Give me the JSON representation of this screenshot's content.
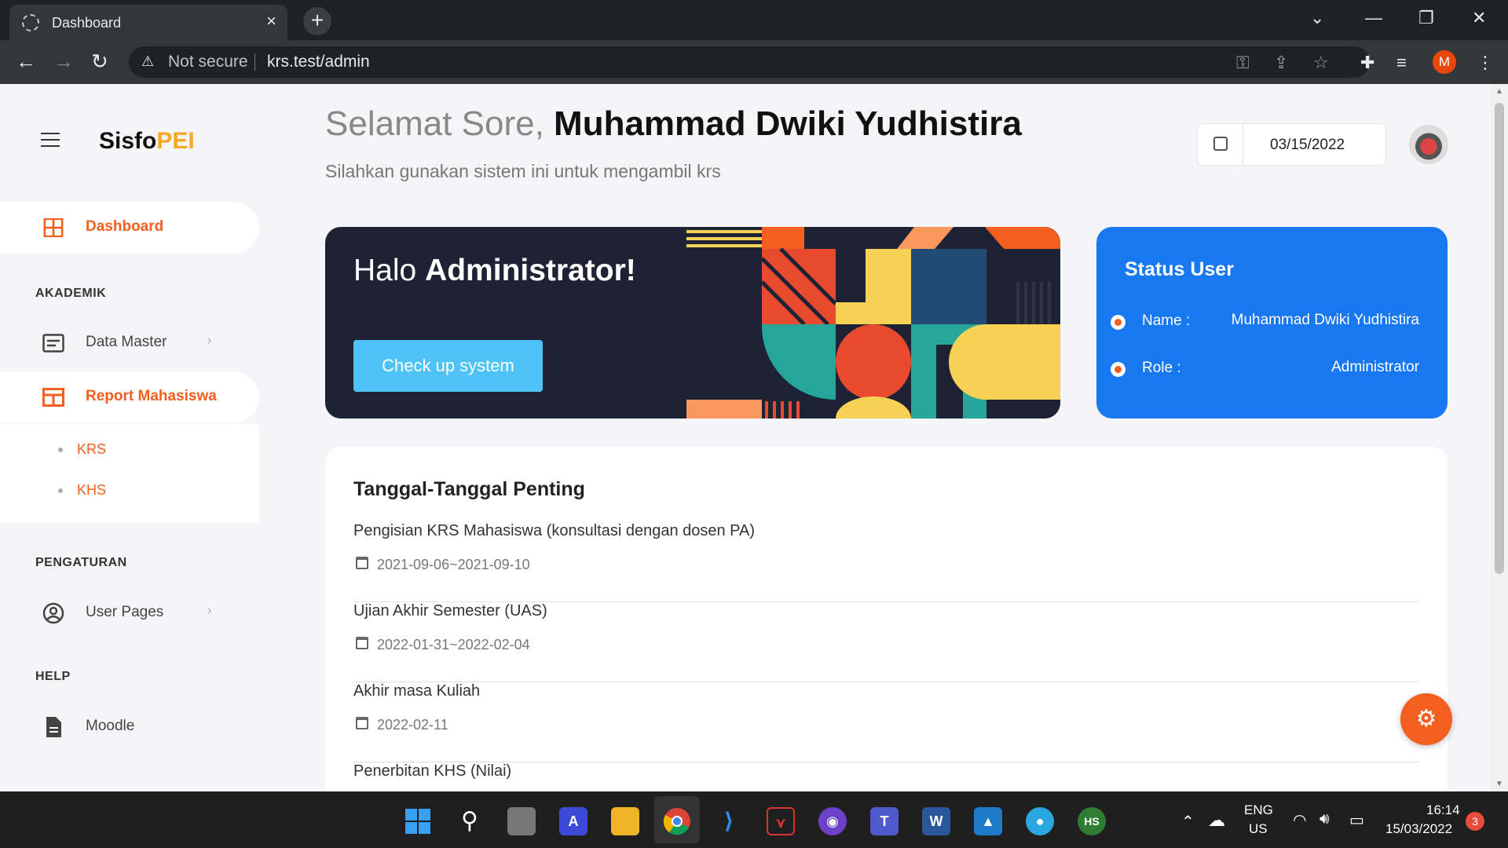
{
  "browser": {
    "tab_title": "Dashboard",
    "security_label": "Not secure",
    "url": "krs.test/admin",
    "profile_initial": "M"
  },
  "sidebar": {
    "brand_main": "Sisfo",
    "brand_accent": "PEI",
    "dashboard": "Dashboard",
    "section_akademik": "AKADEMIK",
    "data_master": "Data Master",
    "report_mahasiswa": "Report Mahasiswa",
    "sub_krs": "KRS",
    "sub_khs": "KHS",
    "section_pengaturan": "PENGATURAN",
    "user_pages": "User Pages",
    "section_help": "HELP",
    "moodle": "Moodle"
  },
  "header": {
    "greeting": "Selamat Sore,",
    "user_name": "Muhammad Dwiki Yudhistira",
    "subtitle": "Silahkan gunakan sistem ini untuk mengambil krs",
    "date": "03/15/2022"
  },
  "hero": {
    "hello": "Halo",
    "role": "Administrator!",
    "button": "Check up system"
  },
  "status": {
    "title": "Status User",
    "name_label": "Name :",
    "name_value": "Muhammad Dwiki Yudhistira",
    "role_label": "Role :",
    "role_value": "Administrator"
  },
  "dates": {
    "title": "Tanggal-Tanggal Penting",
    "items": [
      {
        "event": "Pengisian KRS Mahasiswa (konsultasi dengan dosen PA)",
        "date": "2021-09-06~2021-09-10"
      },
      {
        "event": "Ujian Akhir Semester (UAS)",
        "date": "2022-01-31~2022-02-04"
      },
      {
        "event": "Akhir masa Kuliah",
        "date": "2022-02-11"
      },
      {
        "event": "Penerbitan KHS (Nilai)",
        "date": ""
      }
    ]
  },
  "taskbar": {
    "lang_top": "ENG",
    "lang_bottom": "US",
    "time": "16:14",
    "date": "15/03/2022",
    "notifications": "3"
  },
  "colors": {
    "accent": "#f25f1e",
    "brand_yellow": "#f9a825",
    "hero_bg": "#1e2235",
    "status_bg": "#1778f2",
    "button": "#4fc3f7"
  }
}
